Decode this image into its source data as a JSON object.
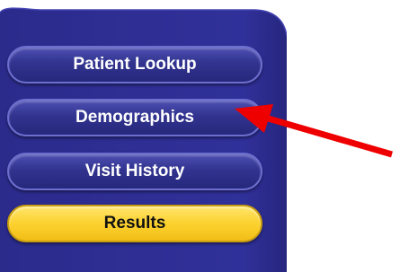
{
  "nav": {
    "items": [
      {
        "label": "Patient Lookup",
        "state": "normal"
      },
      {
        "label": "Demographics",
        "state": "normal"
      },
      {
        "label": "Visit History",
        "state": "normal"
      },
      {
        "label": "Results",
        "state": "selected"
      }
    ]
  },
  "colors": {
    "panel": "#2e2e93",
    "button_blue": "#31338f",
    "button_selected": "#fcd22f",
    "arrow": "#ee0000"
  },
  "annotation": {
    "icon": "red-arrow-icon",
    "points_to": "Demographics"
  }
}
